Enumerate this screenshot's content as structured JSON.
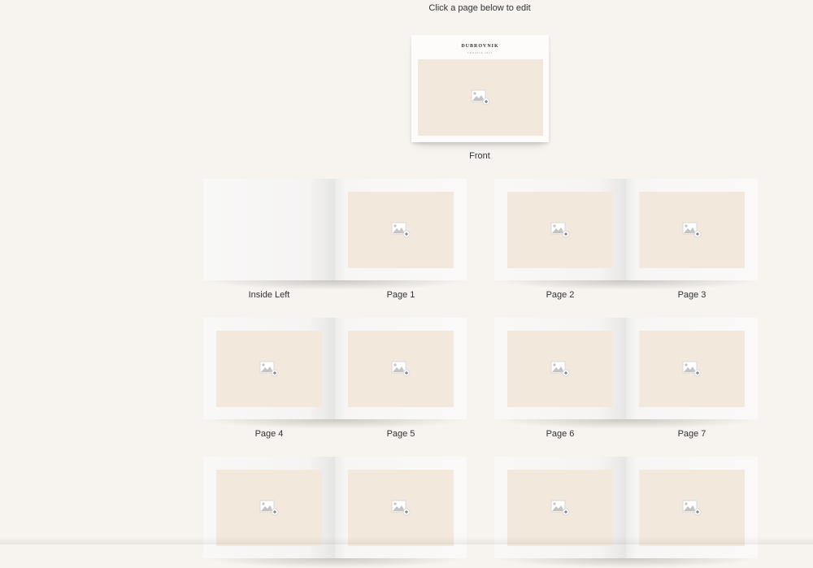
{
  "header": {
    "instruction": "Click a page below to edit"
  },
  "cover": {
    "title": "DUBROVNIK",
    "subtitle": "CROATIA 2023",
    "label": "Front",
    "photo_icon": "add-photo-icon"
  },
  "spreads": [
    {
      "left": {
        "label": "Inside Left",
        "has_photo": false
      },
      "right": {
        "label": "Page 1",
        "has_photo": true
      }
    },
    {
      "left": {
        "label": "Page 2",
        "has_photo": true
      },
      "right": {
        "label": "Page 3",
        "has_photo": true
      }
    },
    {
      "left": {
        "label": "Page 4",
        "has_photo": true
      },
      "right": {
        "label": "Page 5",
        "has_photo": true
      }
    },
    {
      "left": {
        "label": "Page 6",
        "has_photo": true
      },
      "right": {
        "label": "Page 7",
        "has_photo": true
      }
    },
    {
      "left": {
        "label": "",
        "has_photo": true
      },
      "right": {
        "label": "",
        "has_photo": true
      }
    },
    {
      "left": {
        "label": "",
        "has_photo": true
      },
      "right": {
        "label": "",
        "has_photo": true
      }
    }
  ],
  "colors": {
    "background": "#f7f3ee",
    "photo_slot": "#f2e9dc",
    "page": "#faf9f8"
  }
}
